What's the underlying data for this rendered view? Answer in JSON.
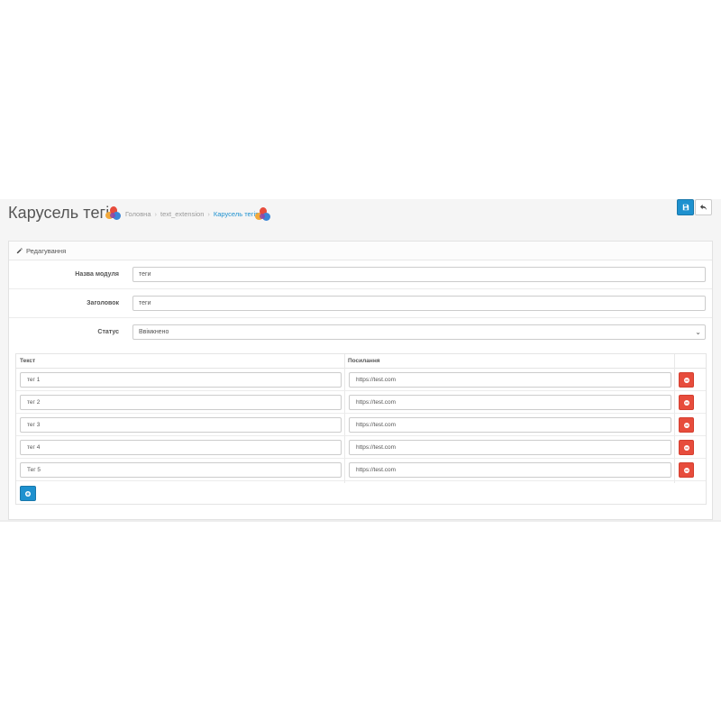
{
  "header": {
    "title": "Карусель тегів",
    "breadcrumb": [
      "Головна",
      "text_extension",
      "Карусель тегів"
    ],
    "breadcrumb_separator": "›"
  },
  "toolbar": {
    "save_icon": "save-icon",
    "back_icon": "reply-icon"
  },
  "panel": {
    "heading": "Редагування",
    "heading_icon": "pencil-icon"
  },
  "form": {
    "module_name_label": "Назва модуля",
    "module_name_value": "теги",
    "heading_label": "Заголовок",
    "heading_value": "теги",
    "status_label": "Статус",
    "status_value": "Ввімкнено"
  },
  "table": {
    "columns": [
      "Текст",
      "Посилання"
    ],
    "rows": [
      {
        "text": "тег 1",
        "link": "https://test.com"
      },
      {
        "text": "тег 2",
        "link": "https://test.com"
      },
      {
        "text": "тег 3",
        "link": "https://test.com"
      },
      {
        "text": "тег 4",
        "link": "https://test.com"
      },
      {
        "text": "Тег 5",
        "link": "https://test.com"
      }
    ]
  },
  "colors": {
    "primary": "#1e91cf",
    "danger": "#e74c3c",
    "link_active": "#1e91cf"
  }
}
